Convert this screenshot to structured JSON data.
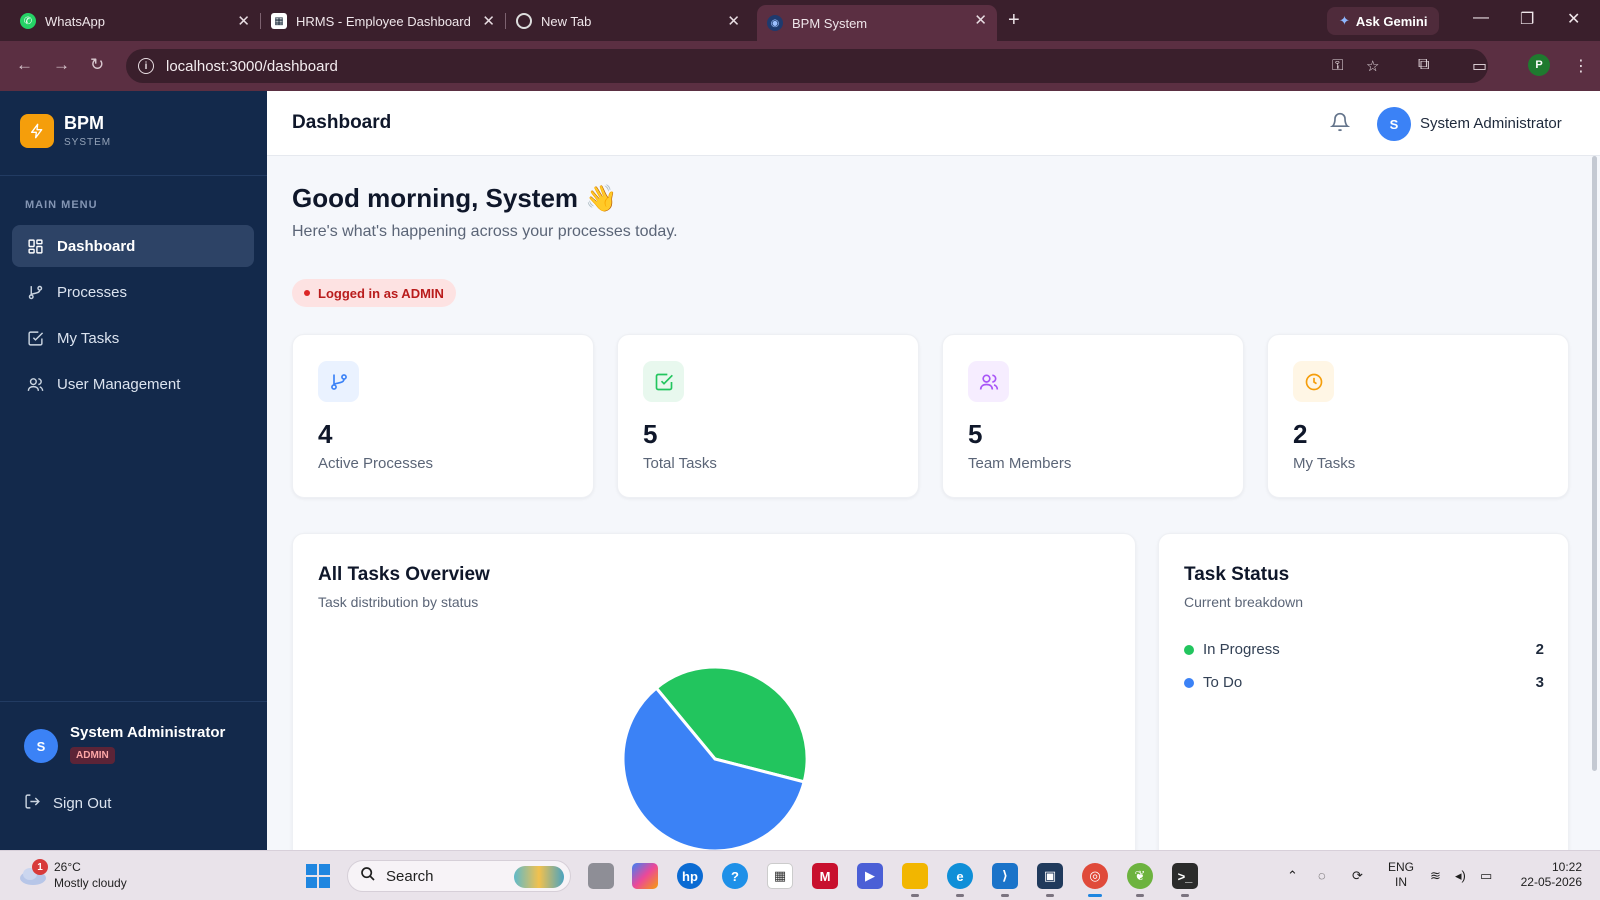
{
  "browser": {
    "tabs": [
      {
        "title": "WhatsApp",
        "active": false
      },
      {
        "title": "HRMS - Employee Dashboard",
        "active": false
      },
      {
        "title": "New Tab",
        "active": false
      },
      {
        "title": "BPM System",
        "active": true
      }
    ],
    "ask_gemini": "Ask Gemini",
    "url": "localhost:3000/dashboard"
  },
  "sidebar": {
    "brand_name": "BPM",
    "brand_sub": "SYSTEM",
    "menu_title": "MAIN MENU",
    "items": [
      {
        "label": "Dashboard",
        "icon": "grid-icon",
        "active": true
      },
      {
        "label": "Processes",
        "icon": "git-branch-icon",
        "active": false
      },
      {
        "label": "My Tasks",
        "icon": "check-square-icon",
        "active": false
      },
      {
        "label": "User Management",
        "icon": "users-icon",
        "active": false
      }
    ],
    "user": {
      "initial": "S",
      "name": "System Administrator",
      "role": "ADMIN"
    },
    "sign_out": "Sign Out"
  },
  "topbar": {
    "title": "Dashboard",
    "user_initial": "S",
    "user_name": "System Administrator"
  },
  "main": {
    "greeting": "Good morning, System",
    "greeting_emoji": "👋",
    "subtitle": "Here's what's happening across your processes today.",
    "login_badge": "Logged in as ADMIN",
    "stats": [
      {
        "value": "4",
        "label": "Active Processes",
        "icon": "git-branch-icon",
        "color": "#3b82f6"
      },
      {
        "value": "5",
        "label": "Total Tasks",
        "icon": "check-square-icon",
        "color": "#22c55e"
      },
      {
        "value": "5",
        "label": "Team Members",
        "icon": "users-icon",
        "color": "#a855f7"
      },
      {
        "value": "2",
        "label": "My Tasks",
        "icon": "clock-icon",
        "color": "#f59e0b"
      }
    ],
    "overview": {
      "title": "All Tasks Overview",
      "subtitle": "Task distribution by status"
    },
    "status_panel": {
      "title": "Task Status",
      "subtitle": "Current breakdown",
      "rows": [
        {
          "label": "In Progress",
          "count": "2",
          "color": "#22c55e"
        },
        {
          "label": "To Do",
          "count": "3",
          "color": "#3b82f6"
        }
      ]
    }
  },
  "chart_data": {
    "type": "pie",
    "categories": [
      "In Progress",
      "To Do"
    ],
    "values": [
      2,
      3
    ],
    "colors": [
      "#22c55e",
      "#3b82f6"
    ]
  },
  "taskbar": {
    "weather_badge": "1",
    "temperature": "26°C",
    "condition": "Mostly cloudy",
    "search": "Search",
    "lang_top": "ENG",
    "lang_bottom": "IN",
    "time": "10:22",
    "date": "22-05-2026"
  }
}
